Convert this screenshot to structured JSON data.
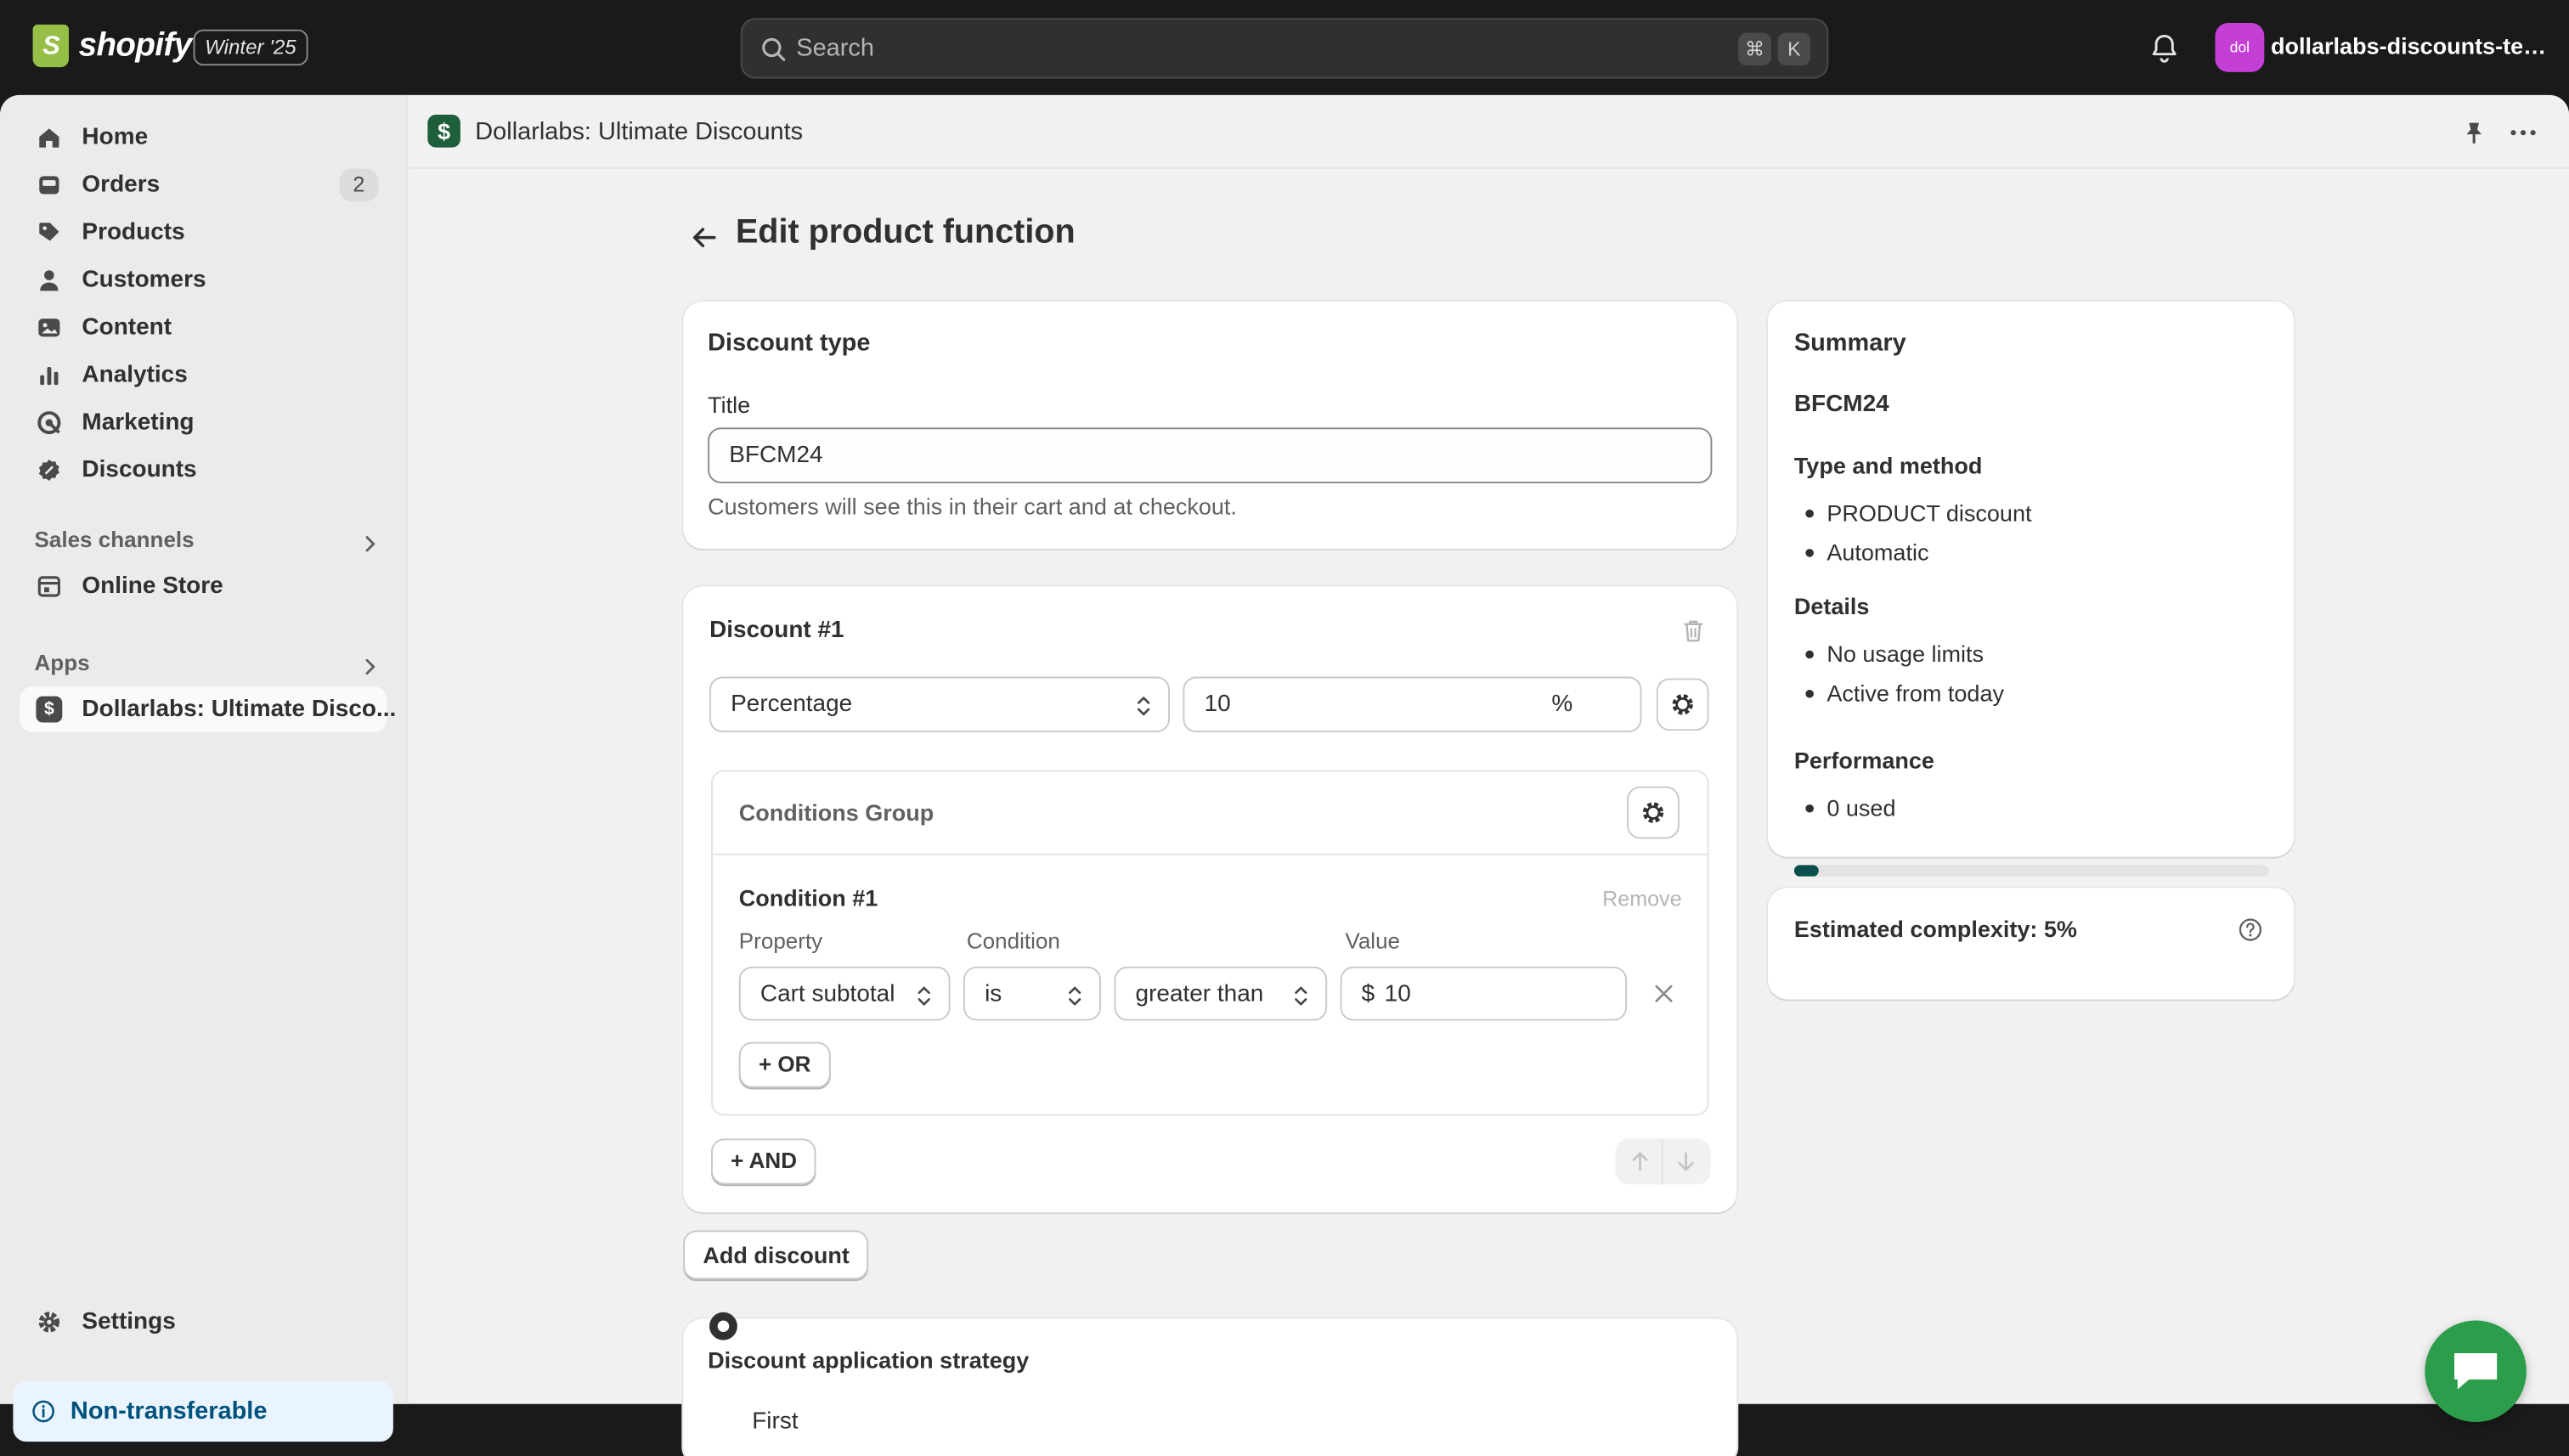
{
  "topbar": {
    "brand": "shopify",
    "edition": "Winter '25",
    "search_placeholder": "Search",
    "shortcut_cmd": "⌘",
    "shortcut_key": "K",
    "store_initials": "dol",
    "store_name": "dollarlabs-discounts-test..."
  },
  "sidebar": {
    "items": [
      {
        "label": "Home",
        "icon": "home-icon"
      },
      {
        "label": "Orders",
        "icon": "orders-icon",
        "count": "2"
      },
      {
        "label": "Products",
        "icon": "tag-icon"
      },
      {
        "label": "Customers",
        "icon": "person-icon"
      },
      {
        "label": "Content",
        "icon": "content-icon"
      },
      {
        "label": "Analytics",
        "icon": "chart-icon"
      },
      {
        "label": "Marketing",
        "icon": "target-icon"
      },
      {
        "label": "Discounts",
        "icon": "discount-icon"
      }
    ],
    "sales_channels_label": "Sales channels",
    "online_store_label": "Online Store",
    "apps_label": "Apps",
    "app_item_label": "Dollarlabs: Ultimate Disco...",
    "settings_label": "Settings",
    "non_transferable_label": "Non-transferable"
  },
  "app_header": {
    "title": "Dollarlabs: Ultimate Discounts"
  },
  "page": {
    "title": "Edit product function"
  },
  "discount_type_card": {
    "heading": "Discount type",
    "title_label": "Title",
    "title_value": "BFCM24",
    "help_text": "Customers will see this in their cart and at checkout."
  },
  "discount_card": {
    "heading": "Discount #1",
    "type_value": "Percentage",
    "amount_value": "10",
    "amount_suffix": "%",
    "conditions_group_label": "Conditions Group",
    "condition_title": "Condition #1",
    "remove_label": "Remove",
    "property_label": "Property",
    "condition_label": "Condition",
    "value_label": "Value",
    "property_value": "Cart subtotal",
    "operator_is": "is",
    "operator_cmp": "greater than",
    "value_prefix": "$",
    "value_amount": "10",
    "or_button": "+ OR",
    "and_button": "+ AND"
  },
  "add_discount_button": "Add discount",
  "strategy_card": {
    "heading": "Discount application strategy",
    "option_first": "First"
  },
  "summary": {
    "heading": "Summary",
    "code": "BFCM24",
    "type_heading": "Type and method",
    "type_items": [
      "PRODUCT discount",
      "Automatic"
    ],
    "details_heading": "Details",
    "details_items": [
      "No usage limits",
      "Active from today"
    ],
    "performance_heading": "Performance",
    "performance_items": [
      "0 used"
    ]
  },
  "complexity": {
    "label": "Estimated complexity: 5%",
    "percent": 5
  },
  "colors": {
    "accent": "#0b4f4d",
    "topbar": "#1a1a1a",
    "chat": "#2c9e4b",
    "info_bg": "#eaf4ff"
  }
}
